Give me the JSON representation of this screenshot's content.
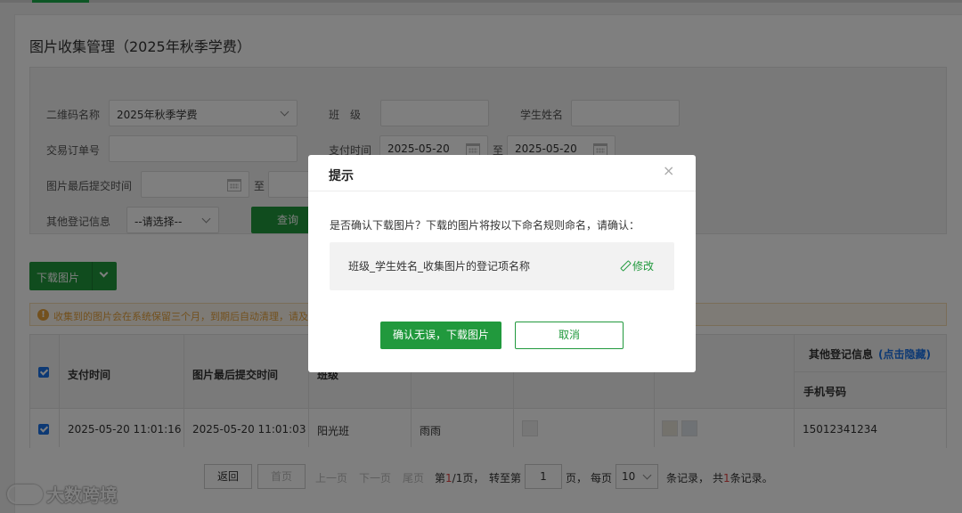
{
  "page": {
    "title": "图片收集管理（2025年秋季学费）"
  },
  "filters": {
    "qrcode_label": "二维码名称",
    "qrcode_value": "2025年秋季学费",
    "class_label": "班　级",
    "student_label": "学生姓名",
    "order_label": "交易订单号",
    "paytime_label": "支付时间",
    "paytime_start": "2025-05-20",
    "paytime_to": "至",
    "paytime_end": "2025-05-20",
    "lastsubmit_label": "图片最后提交时间",
    "lastsubmit_to": "至",
    "other_label": "其他登记信息",
    "other_value": "--请选择--",
    "query_label": "查询"
  },
  "toolbar": {
    "download_label": "下载图片"
  },
  "notice": {
    "icon": "!",
    "text": "收集到的图片会在系统保留三个月，到期后自动清理，请及时下"
  },
  "table": {
    "headers": {
      "paytime": "支付时间",
      "lastsubmit": "图片最后提交时间",
      "class": "班级",
      "student": "",
      "receipt": "",
      "signature": "",
      "other": "其他登记信息",
      "hide_link": "(点击隐藏)",
      "phone": "手机号码"
    },
    "rows": [
      {
        "paytime": "2025-05-20 11:01:16",
        "lastsubmit": "2025-05-20 11:01:03",
        "class": "阳光班",
        "student": "雨雨",
        "phone": "15012341234"
      }
    ]
  },
  "pager": {
    "back": "返回",
    "first": "首页",
    "prev": "上一页",
    "next": "下一页",
    "last": "尾页",
    "page_prefix": "第",
    "current": "1",
    "page_sep": "/1页，",
    "goto": "转至第",
    "goto_value": "1",
    "goto_suffix": "页，",
    "per_page": "每页",
    "page_size": "10",
    "records": "条记录，",
    "total_prefix": "共",
    "total": "1",
    "total_suffix": "条记录。"
  },
  "watermark": {
    "text": "大数跨境"
  },
  "dialog": {
    "title": "提示",
    "close": "×",
    "message": "是否确认下载图片？下载的图片将按以下命名规则命名，请确认：",
    "rule": "班级_学生姓名_收集图片的登记项名称",
    "edit": "修改",
    "confirm": "确认无误，下载图片",
    "cancel": "取消"
  },
  "colors": {
    "brand_green": "#21993d",
    "link_blue": "#1a73e8",
    "warning": "#e6a23c"
  }
}
